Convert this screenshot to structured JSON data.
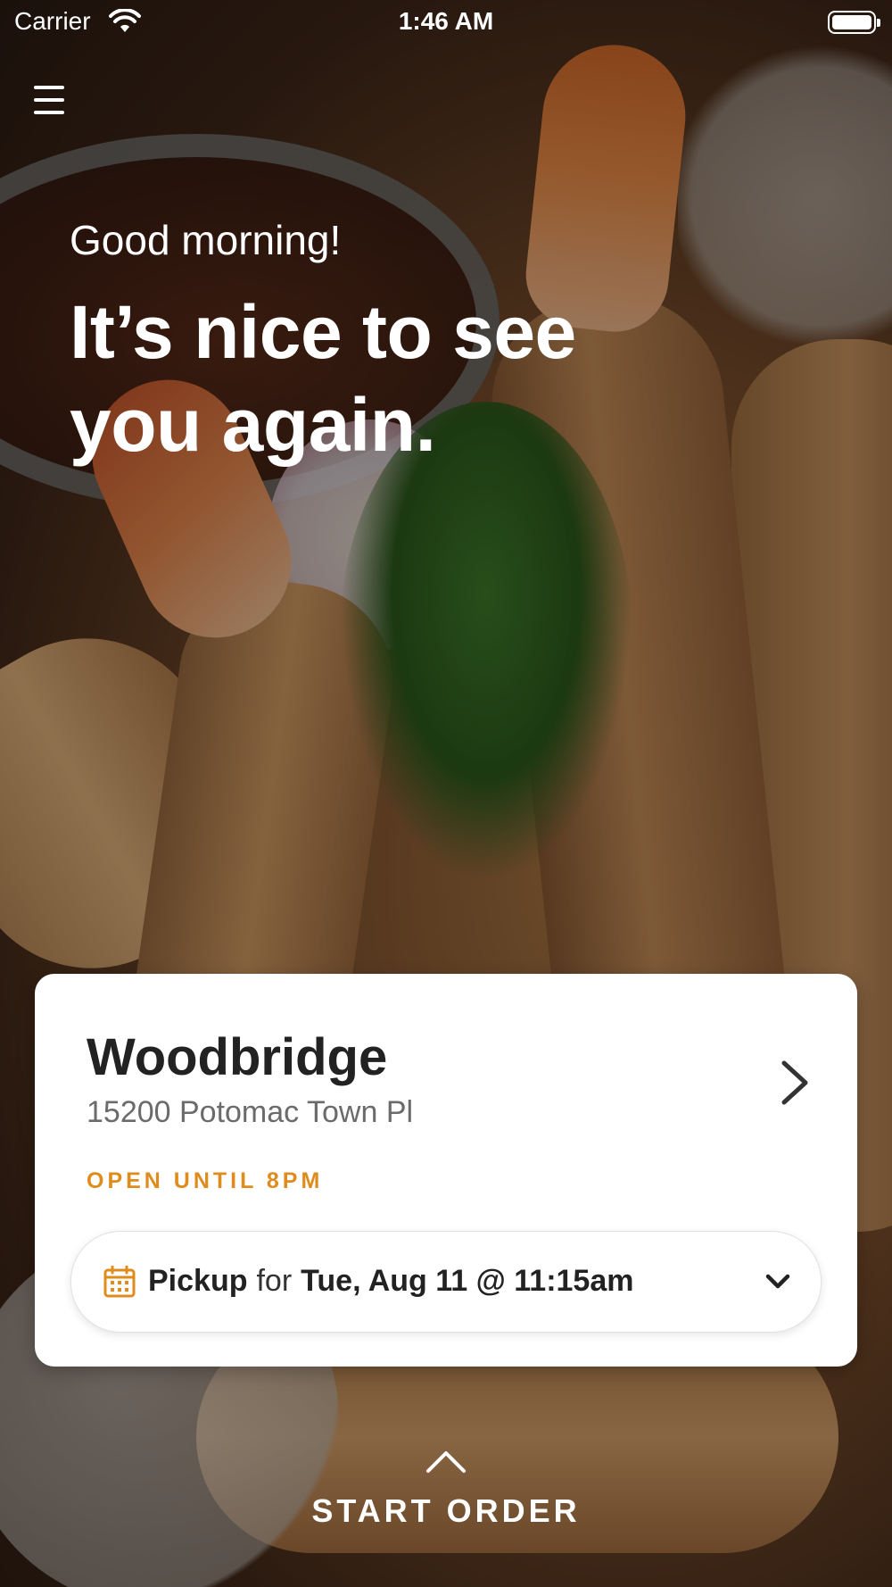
{
  "status_bar": {
    "carrier": "Carrier",
    "time": "1:46 AM"
  },
  "hero": {
    "greeting": "Good morning!",
    "headline": "It’s nice to see you again."
  },
  "location_card": {
    "name": "Woodbridge",
    "address": "15200 Potomac Town Pl",
    "hours": "OPEN UNTIL 8PM",
    "order": {
      "mode": "Pickup",
      "connector": "for",
      "datetime": "Tue, Aug 11 @ 11:15am"
    }
  },
  "footer": {
    "start_order_label": "START ORDER"
  },
  "colors": {
    "accent": "#df8c1c",
    "card_background": "#ffffff",
    "text_primary": "#222222",
    "text_secondary": "#6b6b6b"
  },
  "icons": [
    "wifi-icon",
    "battery-icon",
    "hamburger-menu-icon",
    "chevron-right-icon",
    "calendar-icon",
    "chevron-down-icon",
    "chevron-up-icon"
  ]
}
